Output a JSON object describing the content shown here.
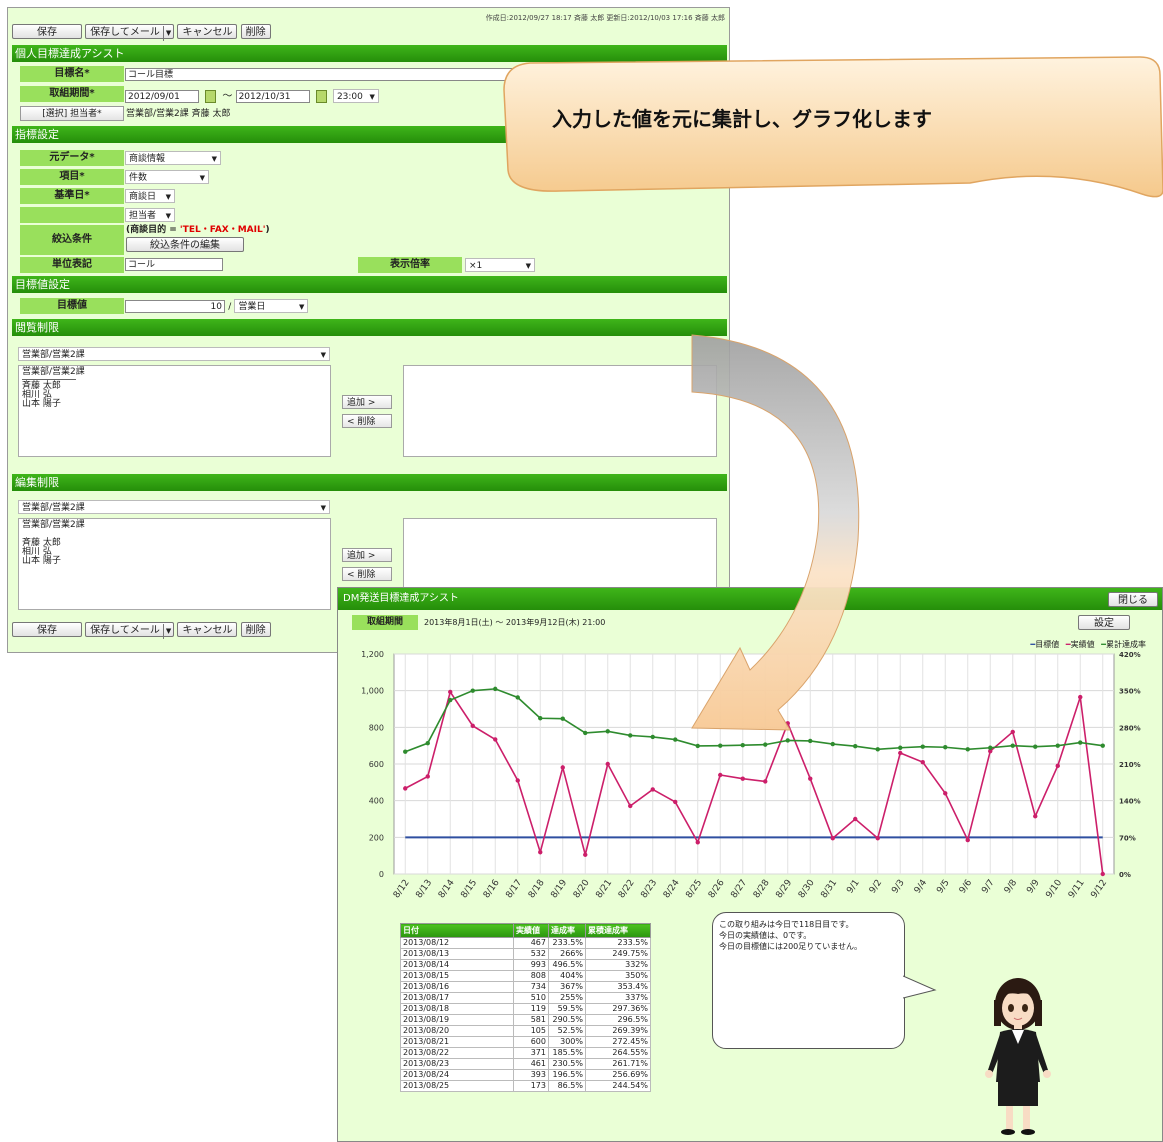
{
  "form": {
    "meta": "作成日:2012/09/27 18:17 斉藤 太郎 更新日:2012/10/03 17:16 斉藤 太郎",
    "toolbar": {
      "save": "保存",
      "save_mail": "保存してメール",
      "cancel": "キャンセル",
      "delete": "削除"
    },
    "sections": {
      "personal": "個人目標達成アシスト",
      "indicator": "指標設定",
      "target": "目標値設定",
      "view": "閲覧制限",
      "edit": "編集制限"
    },
    "goal_name_label": "目標名*",
    "goal_name_value": "コール目標",
    "period_label": "取組期間*",
    "period_start": "2012/09/01",
    "period_sep": "～",
    "period_end": "2012/10/31",
    "period_time": "23:00",
    "owner_button": "[選択] 担当者*",
    "owner_value": "営業部/営業2課 斉藤 太郎",
    "source_label": "元データ*",
    "source_value": "商談情報",
    "item_label": "項目*",
    "item_value": "件数",
    "base_date_label": "基準日*",
    "base_date_value": "商談日",
    "assignee_value": "担当者",
    "filter_label": "絞込条件",
    "filter_condition_prefix": "(商談目的 = ",
    "filter_condition_value": "'TEL・FAX・MAIL'",
    "filter_condition_suffix": ")",
    "filter_edit_button": "絞込条件の編集",
    "unit_label": "単位表記",
    "unit_value": "コール",
    "scale_label": "表示倍率",
    "scale_value": "×1",
    "target_label": "目標値",
    "target_value": "10",
    "target_slash": "/",
    "target_unit": "営業日",
    "view_group": "営業部/営業2課",
    "view_list": [
      "営業部/営業2課",
      "────────",
      "斉藤 太郎",
      "相川 弘",
      "山本 陽子"
    ],
    "add_button": "追加 >",
    "remove_button": "< 削除",
    "edit_group": "営業部/営業2課",
    "edit_list": [
      "営業部/営業2課",
      "",
      "斉藤 太郎",
      "相川 弘",
      "山本 陽子"
    ]
  },
  "callout": {
    "text": "入力した値を元に集計し、グラフ化します"
  },
  "result": {
    "title": "DM発送目標達成アシスト",
    "close_button": "閉じる",
    "settings_button": "設定",
    "period_label": "取組期間",
    "period_value": "2013年8月1日(土) ～ 2013年9月12日(木) 21:00",
    "legend": [
      "目標値",
      "実績値",
      "累計達成率"
    ],
    "table_headers": [
      "日付",
      "実績値",
      "達成率",
      "累積達成率"
    ],
    "table_rows": [
      [
        "2013/08/12",
        "467",
        "233.5%",
        "233.5%"
      ],
      [
        "2013/08/13",
        "532",
        "266%",
        "249.75%"
      ],
      [
        "2013/08/14",
        "993",
        "496.5%",
        "332%"
      ],
      [
        "2013/08/15",
        "808",
        "404%",
        "350%"
      ],
      [
        "2013/08/16",
        "734",
        "367%",
        "353.4%"
      ],
      [
        "2013/08/17",
        "510",
        "255%",
        "337%"
      ],
      [
        "2013/08/18",
        "119",
        "59.5%",
        "297.36%"
      ],
      [
        "2013/08/19",
        "581",
        "290.5%",
        "296.5%"
      ],
      [
        "2013/08/20",
        "105",
        "52.5%",
        "269.39%"
      ],
      [
        "2013/08/21",
        "600",
        "300%",
        "272.45%"
      ],
      [
        "2013/08/22",
        "371",
        "185.5%",
        "264.55%"
      ],
      [
        "2013/08/23",
        "461",
        "230.5%",
        "261.71%"
      ],
      [
        "2013/08/24",
        "393",
        "196.5%",
        "256.69%"
      ],
      [
        "2013/08/25",
        "173",
        "86.5%",
        "244.54%"
      ]
    ],
    "bubble": [
      "この取り組みは今日で118日目です。",
      "今日の実績値は、0です。",
      "今日の目標値には200足りていません。"
    ]
  },
  "colors": {
    "header_green": "#2b9510",
    "label_green": "#99e05c",
    "panel_bg": "#eaffd6",
    "target_line": "#2f4fa0",
    "actual_line": "#cc1f6a",
    "cumulative_line": "#2e8b2e"
  },
  "chart_data": {
    "type": "line",
    "categories": [
      "8/12",
      "8/13",
      "8/14",
      "8/15",
      "8/16",
      "8/17",
      "8/18",
      "8/19",
      "8/20",
      "8/21",
      "8/22",
      "8/23",
      "8/24",
      "8/25",
      "8/26",
      "8/27",
      "8/28",
      "8/29",
      "8/30",
      "8/31",
      "9/1",
      "9/2",
      "9/3",
      "9/4",
      "9/5",
      "9/6",
      "9/7",
      "9/8",
      "9/9",
      "9/10",
      "9/11",
      "9/12"
    ],
    "y_left_ticks": [
      "0",
      "200",
      "400",
      "600",
      "800",
      "1,000",
      "1,200"
    ],
    "y_right_ticks": [
      "0%",
      "70%",
      "140%",
      "210%",
      "280%",
      "350%",
      "420%"
    ],
    "ylim": [
      0,
      1200
    ],
    "y2lim": [
      0,
      420
    ],
    "grid": true,
    "legend_position": "top-right",
    "series": [
      {
        "name": "目標値",
        "axis": "left",
        "values": [
          200,
          200,
          200,
          200,
          200,
          200,
          200,
          200,
          200,
          200,
          200,
          200,
          200,
          200,
          200,
          200,
          200,
          200,
          200,
          200,
          200,
          200,
          200,
          200,
          200,
          200,
          200,
          200,
          200,
          200,
          200,
          200
        ]
      },
      {
        "name": "実績値",
        "axis": "left",
        "values": [
          467,
          532,
          993,
          808,
          734,
          510,
          119,
          581,
          105,
          600,
          371,
          461,
          393,
          173,
          540,
          520,
          505,
          822,
          520,
          195,
          300,
          195,
          660,
          610,
          440,
          185,
          670,
          775,
          315,
          590,
          965,
          0
        ]
      },
      {
        "name": "累計達成率",
        "axis": "right",
        "values": [
          233.5,
          249.75,
          332,
          350,
          353.4,
          337,
          297.36,
          296.5,
          269.39,
          272.45,
          264.55,
          261.71,
          256.69,
          244.54,
          245,
          246,
          247,
          255,
          254,
          248,
          244,
          238,
          241,
          243,
          242,
          238,
          241,
          245,
          243,
          245,
          251,
          245
        ]
      }
    ]
  }
}
